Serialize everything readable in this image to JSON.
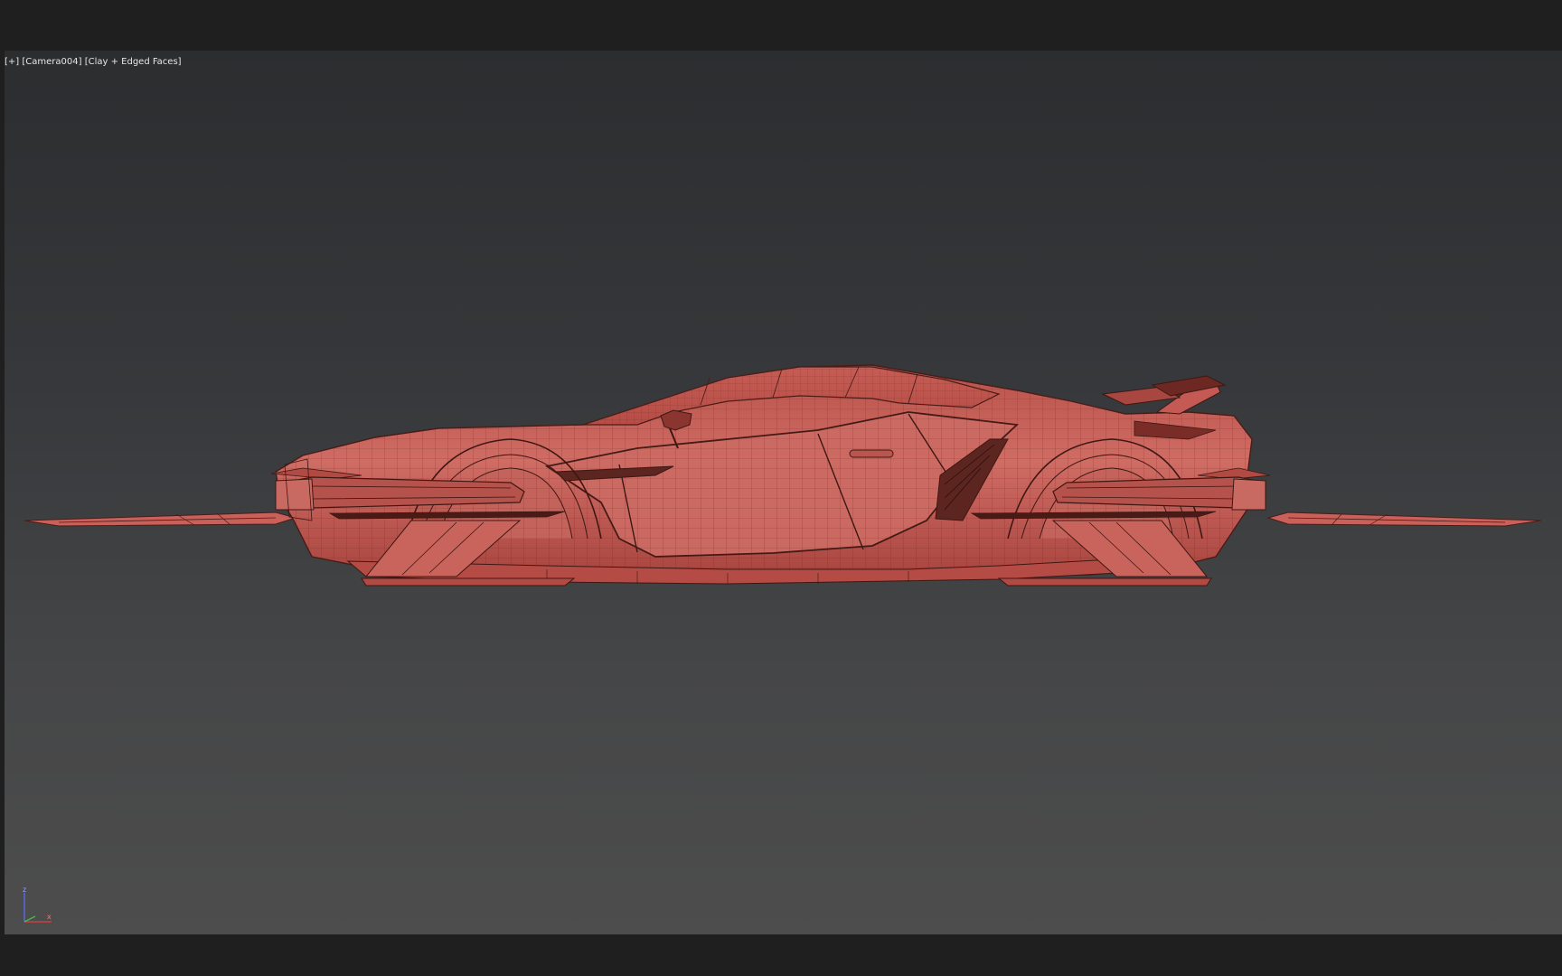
{
  "viewport": {
    "menu": "[+]",
    "camera": "[Camera004]",
    "shading": "[Clay + Edged Faces]"
  },
  "gizmo": {
    "z_label": "z",
    "x_label": "x"
  },
  "colors": {
    "background_top": "#2b2d2f",
    "background_bottom": "#4d4d4d",
    "clay": "#c9615a",
    "clay_light": "#d4807a",
    "clay_dark": "#7a2d27",
    "edge": "#4a1c18",
    "axis_z": "#5a6cf0",
    "axis_x": "#e04040",
    "axis_y": "#40c040"
  },
  "icons": [
    "axis-gizmo-icon"
  ]
}
